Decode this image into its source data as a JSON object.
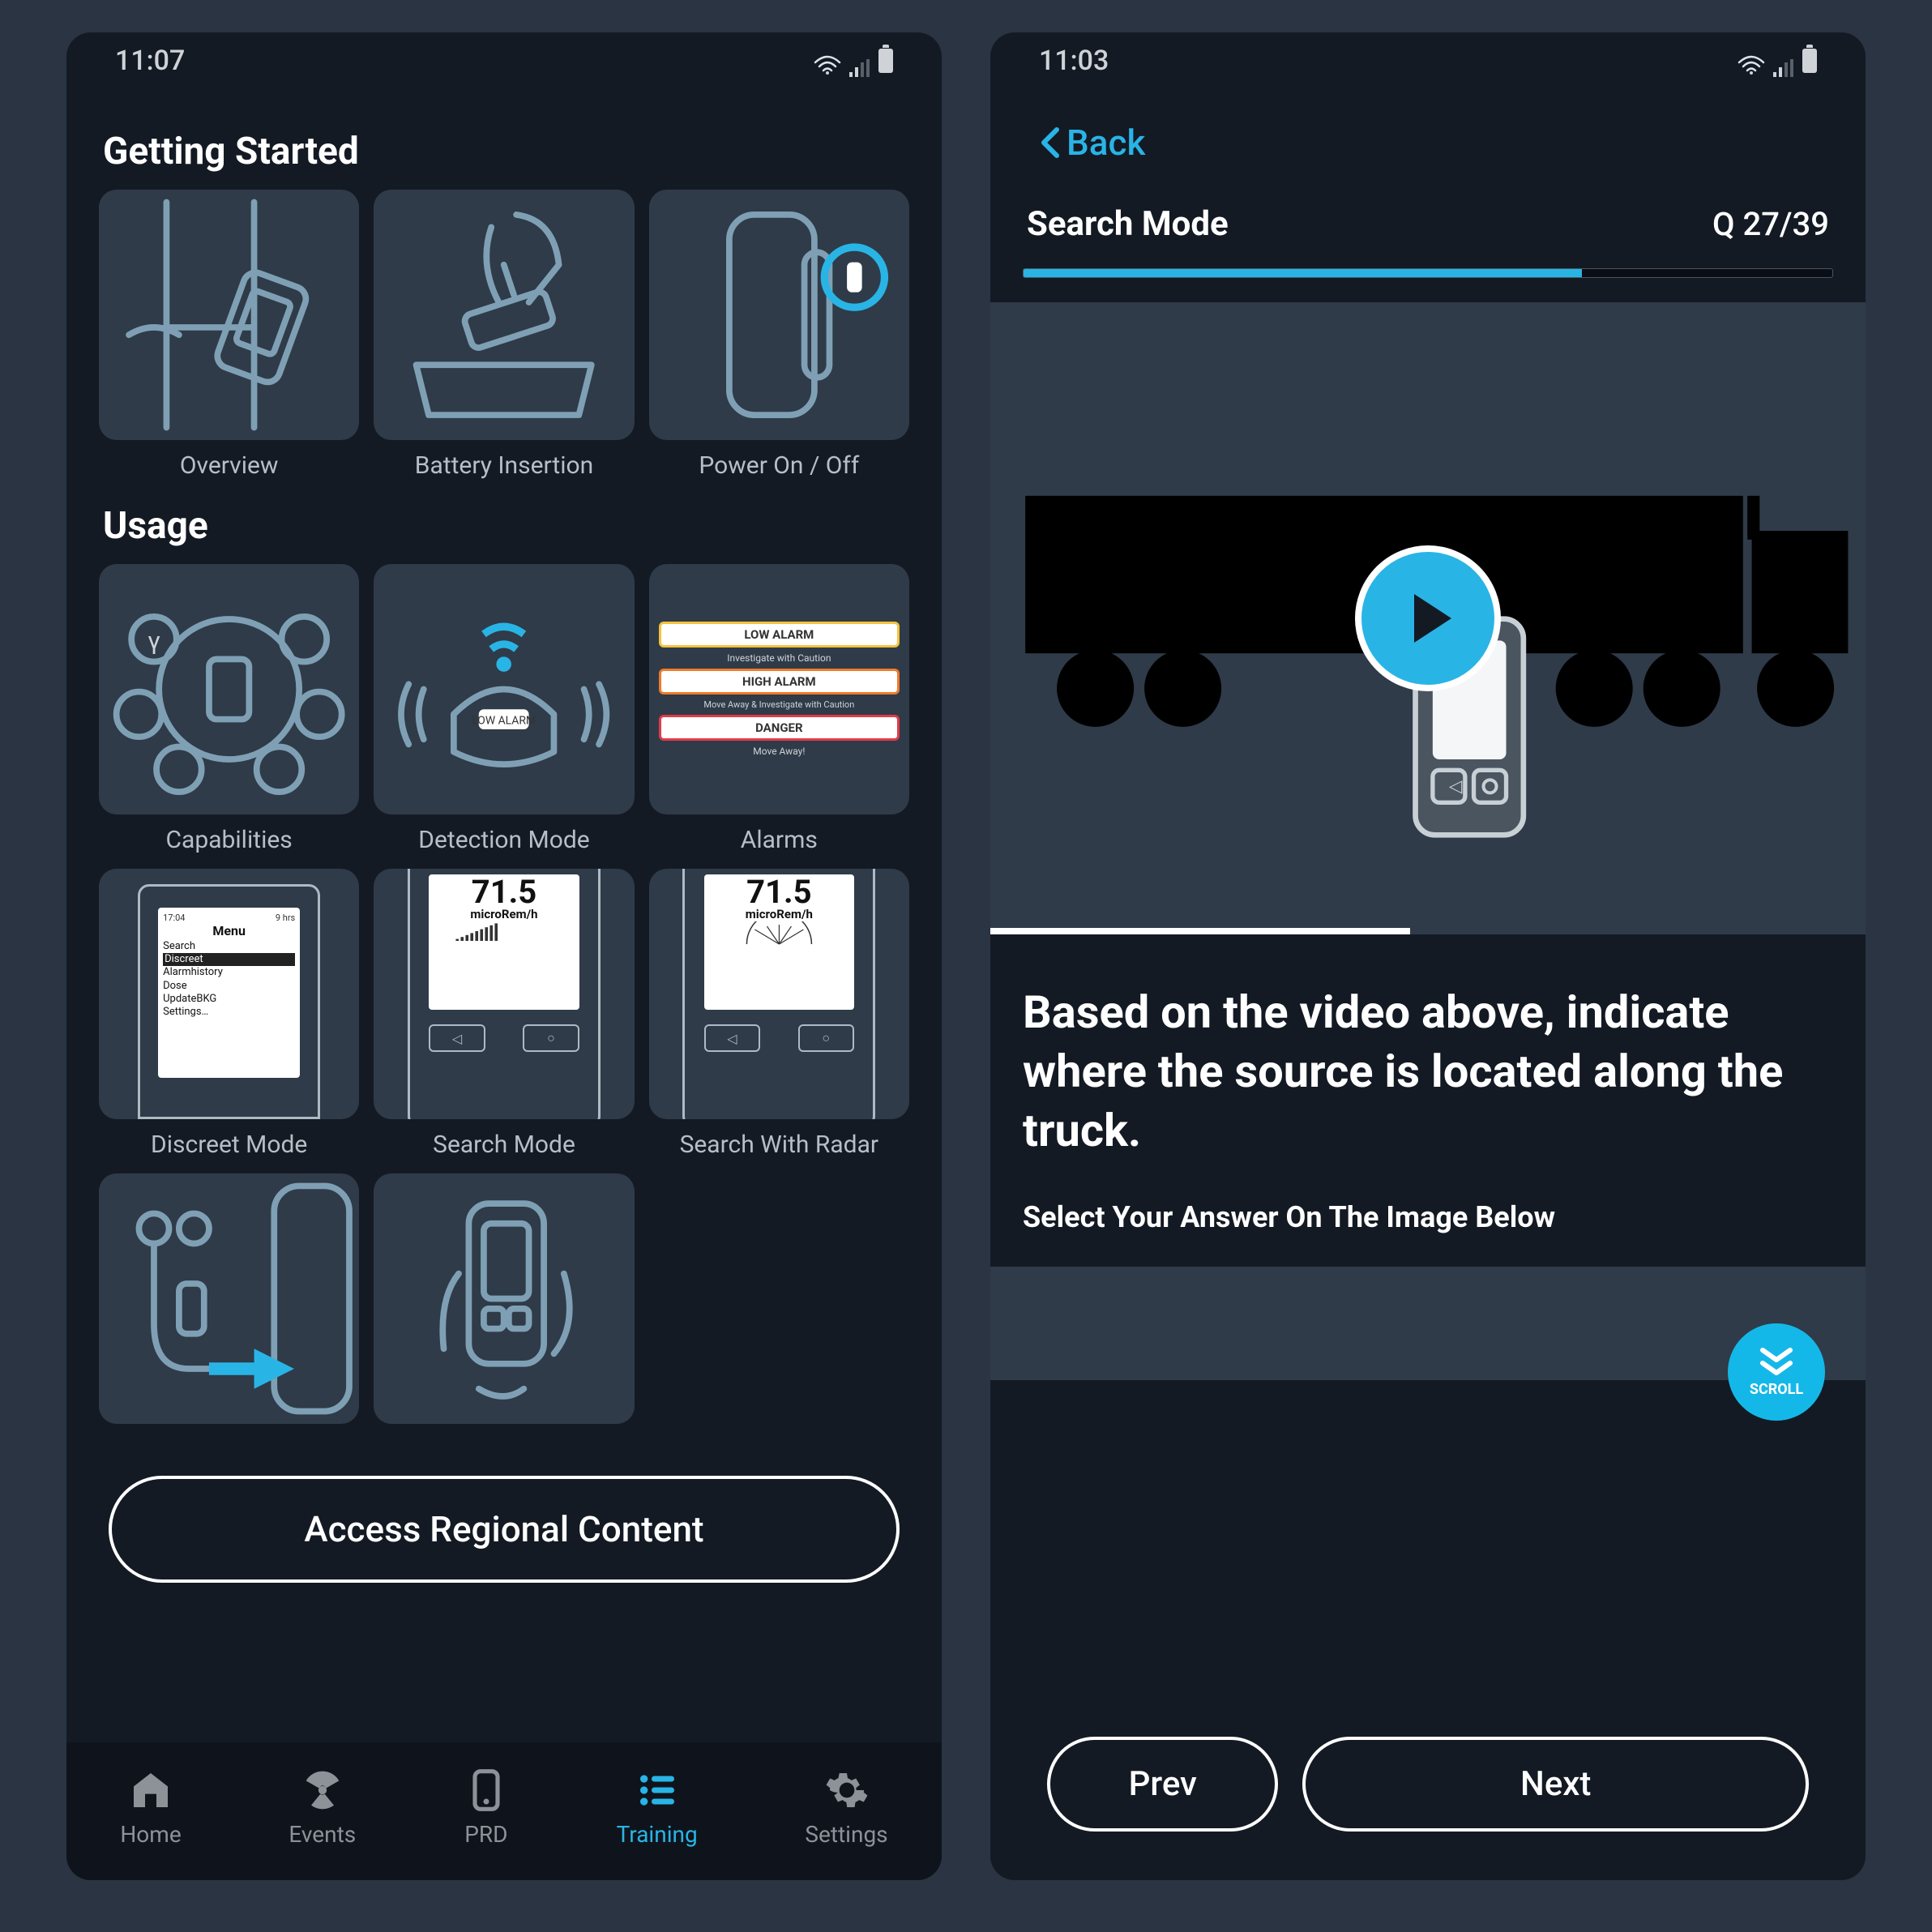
{
  "left": {
    "status_time": "11:07",
    "sections": {
      "getting_started": {
        "title": "Getting Started",
        "items": [
          {
            "label": "Overview"
          },
          {
            "label": "Battery Insertion"
          },
          {
            "label": "Power On / Off"
          }
        ]
      },
      "usage": {
        "title": "Usage",
        "items": [
          {
            "label": "Capabilities"
          },
          {
            "label": "Detection Mode"
          },
          {
            "label": "Alarms",
            "banners": [
              {
                "text": "LOW ALARM",
                "sub": "Investigate with Caution",
                "color": "#f5c23e"
              },
              {
                "text": "HIGH ALARM",
                "sub": "Move Away & Investigate with Caution",
                "color": "#f07b2a"
              },
              {
                "text": "DANGER",
                "sub": "Move Away!",
                "color": "#e23b4a"
              }
            ]
          },
          {
            "label": "Discreet Mode",
            "menu": {
              "time": "17:04",
              "title": "Menu",
              "items": [
                "Search",
                "Discreet",
                "Alarmhistory",
                "Dose",
                "UpdateBKG",
                "Settings…"
              ],
              "selected": "Discreet"
            }
          },
          {
            "label": "Search Mode",
            "reading": "71.5",
            "unit": "microRem/h"
          },
          {
            "label": "Search With Radar",
            "reading": "71.5",
            "unit": "microRem/h"
          },
          {
            "label": ""
          },
          {
            "label": ""
          }
        ]
      }
    },
    "regional_button": "Access Regional Content",
    "nav": {
      "items": [
        {
          "label": "Home"
        },
        {
          "label": "Events"
        },
        {
          "label": "PRD"
        },
        {
          "label": "Training"
        },
        {
          "label": "Settings"
        }
      ],
      "active_index": 3
    }
  },
  "right": {
    "status_time": "11:03",
    "back_label": "Back",
    "title": "Search Mode",
    "q_counter": "Q 27/39",
    "progress_pct": 69,
    "question": "Based on the video above, indicate where the source is located along the truck.",
    "subprompt": "Select Your Answer On The Image Below",
    "scroll_label": "SCROLL",
    "prev_label": "Prev",
    "next_label": "Next"
  }
}
